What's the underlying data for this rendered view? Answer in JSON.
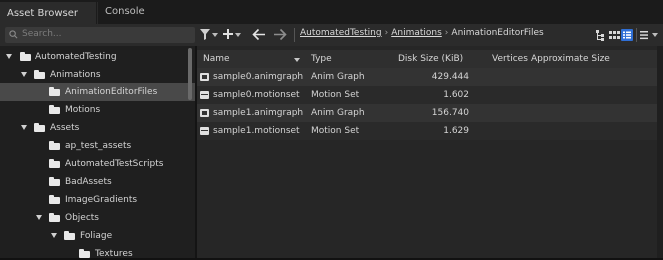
{
  "tabs": [
    {
      "label": "Asset Browser"
    },
    {
      "label": "Console"
    }
  ],
  "search": {
    "placeholder": "Search..."
  },
  "breadcrumb": [
    {
      "label": "AutomatedTesting"
    },
    {
      "label": "Animations"
    },
    {
      "label": "AnimationEditorFiles"
    }
  ],
  "breadcrumb_separator": "›",
  "tree": [
    {
      "label": "AutomatedTesting",
      "expanded": true
    },
    {
      "label": "Animations",
      "expanded": true
    },
    {
      "label": "AnimationEditorFiles",
      "selected": true
    },
    {
      "label": "Motions"
    },
    {
      "label": "Assets",
      "expanded": true
    },
    {
      "label": "ap_test_assets"
    },
    {
      "label": "AutomatedTestScripts"
    },
    {
      "label": "BadAssets"
    },
    {
      "label": "ImageGradients"
    },
    {
      "label": "Objects",
      "expanded": true
    },
    {
      "label": "Foliage",
      "expanded": true
    },
    {
      "label": "Textures"
    }
  ],
  "columns": {
    "name": "Name",
    "type": "Type",
    "disk_size": "Disk Size (KiB)",
    "vertices": "Vertices",
    "approx_size": "Approximate Size"
  },
  "files": [
    {
      "name": "sample0.animgraph",
      "type": "Anim Graph",
      "size": "429.444",
      "icon": "animgraph-icon"
    },
    {
      "name": "sample0.motionset",
      "type": "Motion Set",
      "size": "1.602",
      "icon": "motionset-icon"
    },
    {
      "name": "sample1.animgraph",
      "type": "Anim Graph",
      "size": "156.740",
      "icon": "animgraph-icon"
    },
    {
      "name": "sample1.motionset",
      "type": "Motion Set",
      "size": "1.629",
      "icon": "motionset-icon"
    }
  ],
  "colors": {
    "panel_bg": "#1f1f1f",
    "selection": "#494949",
    "row_alt": "#333333"
  }
}
